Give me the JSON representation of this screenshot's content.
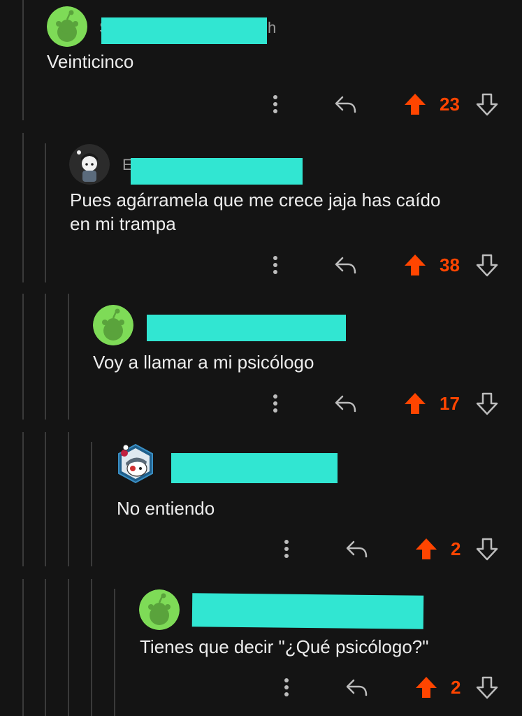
{
  "colors": {
    "background": "#141414",
    "thread_line": "#3a3a3a",
    "upvote": "#ff4500",
    "redaction": "#31e6d2",
    "avatar_green": "#7edb57"
  },
  "comments": [
    {
      "author_initial": "S",
      "author_suffix": "h",
      "body": "Veinticinco",
      "score": "23",
      "avatar": "snoo-green-avatar"
    },
    {
      "author_initial": "E",
      "author_suffix": "",
      "body": "Pues agárramela que me crece jaja has caído\nen mi trampa",
      "score": "38",
      "avatar": "custom-snoo-avatar"
    },
    {
      "author_initial": "",
      "author_suffix": "",
      "body": "Voy a llamar a mi psicólogo",
      "score": "17",
      "avatar": "snoo-green-avatar"
    },
    {
      "author_initial": "",
      "author_suffix": "",
      "body": "No entiendo",
      "score": "2",
      "avatar": "hexagon-snoo-avatar"
    },
    {
      "author_initial": "",
      "author_suffix": "",
      "body": "Tienes que decir \"¿Qué psicólogo?\"",
      "score": "2",
      "avatar": "snoo-green-avatar"
    }
  ],
  "icons": {
    "more": "more-vertical-icon",
    "reply": "reply-icon",
    "upvote": "upvote-arrow-icon",
    "downvote": "downvote-arrow-icon"
  }
}
